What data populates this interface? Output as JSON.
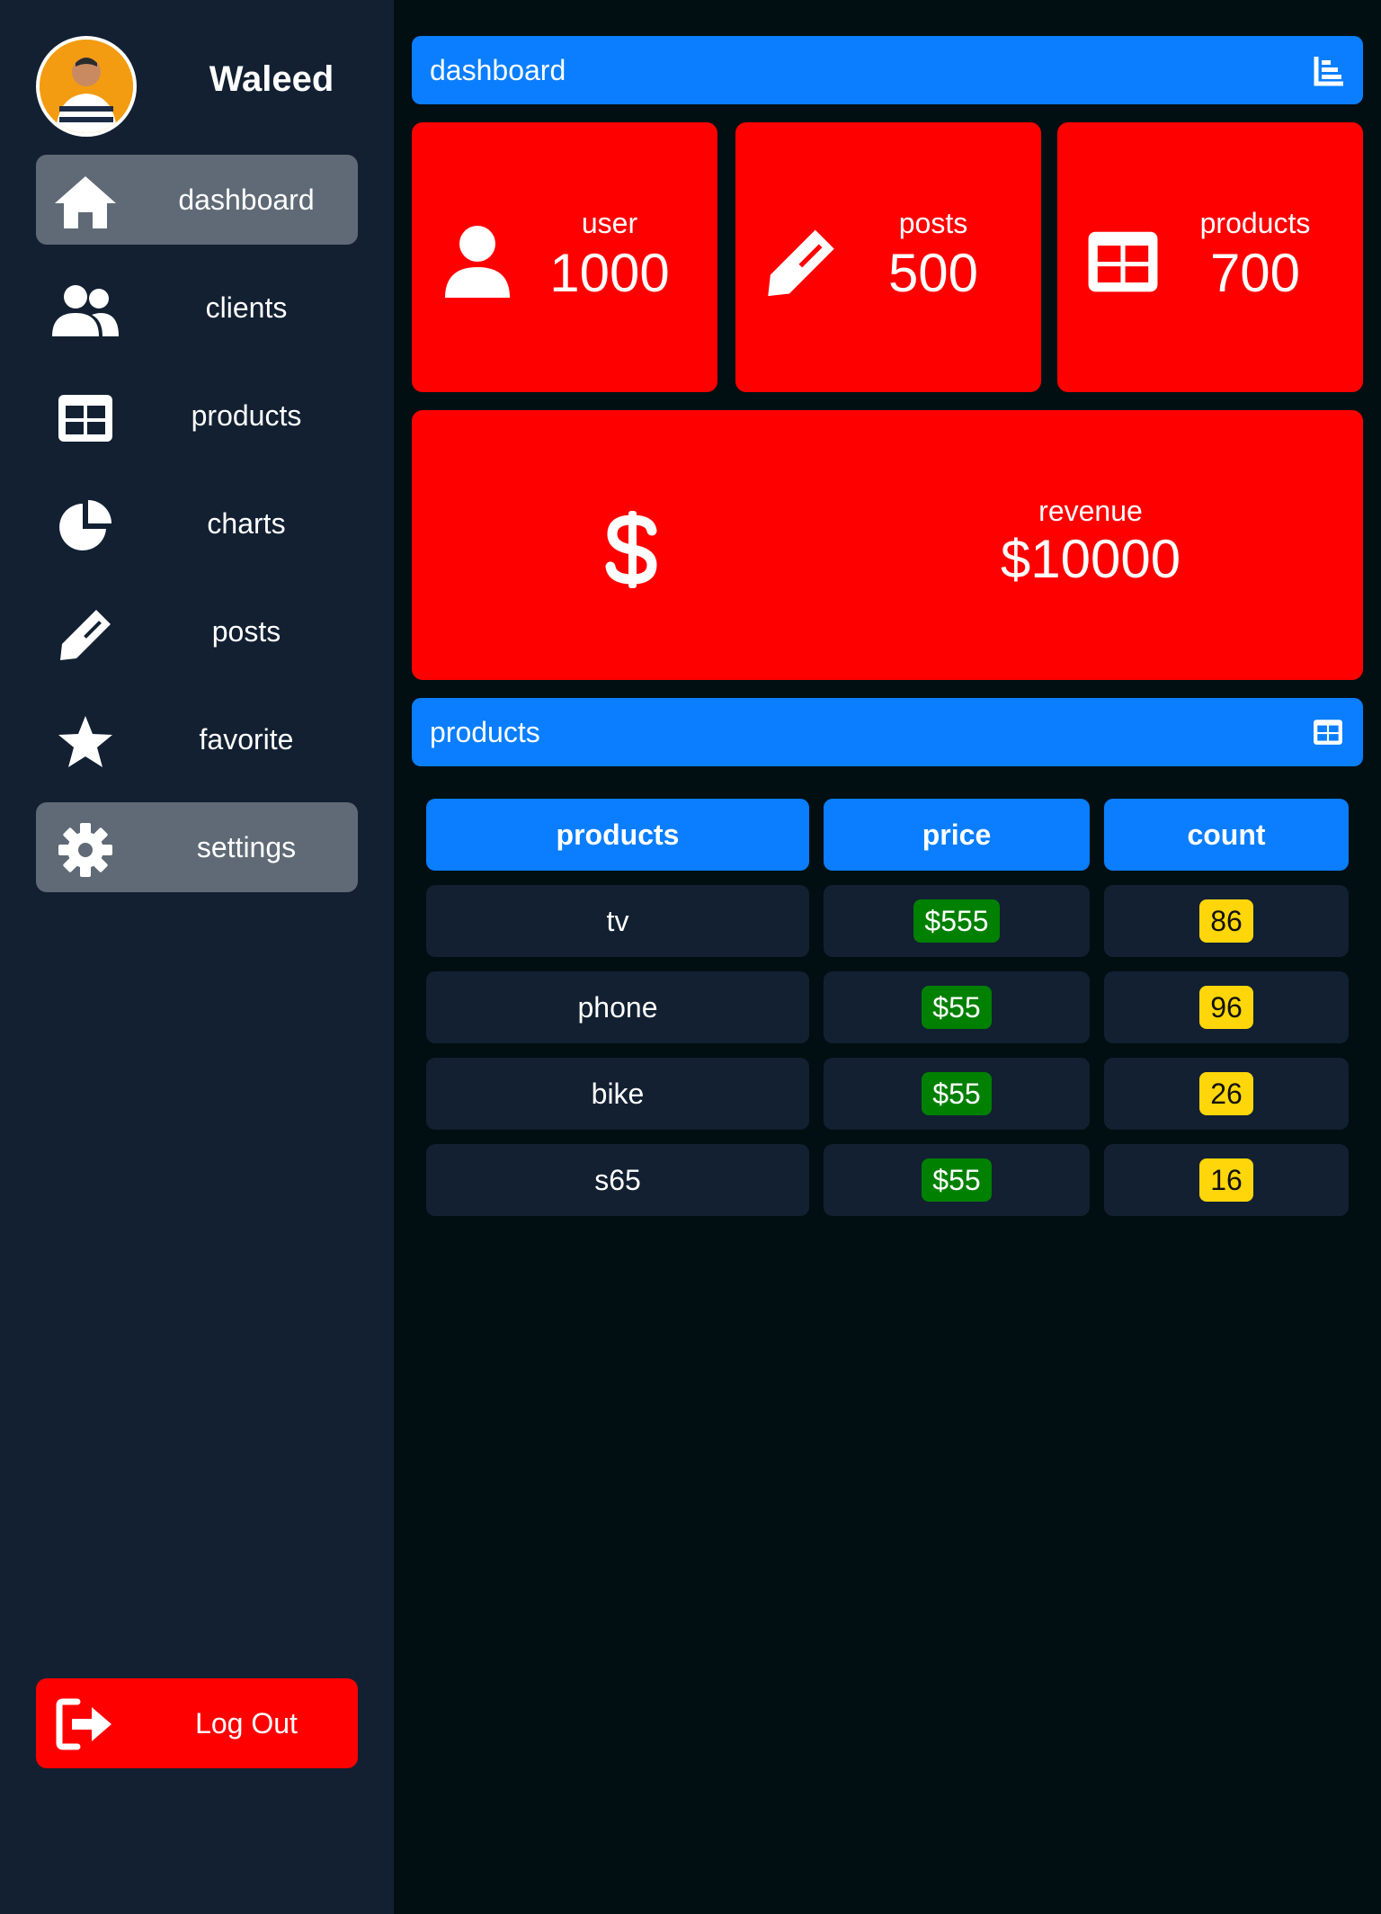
{
  "user": {
    "name": "Waleed"
  },
  "sidebar": {
    "items": [
      {
        "label": "dashboard",
        "icon": "home-icon",
        "active": true
      },
      {
        "label": "clients",
        "icon": "users-icon",
        "active": false
      },
      {
        "label": "products",
        "icon": "table-icon",
        "active": false
      },
      {
        "label": "charts",
        "icon": "pie-chart-icon",
        "active": false
      },
      {
        "label": "posts",
        "icon": "pencil-icon",
        "active": false
      },
      {
        "label": "favorite",
        "icon": "star-icon",
        "active": false
      },
      {
        "label": "settings",
        "icon": "gear-icon",
        "active": true
      }
    ],
    "logout_label": "Log Out"
  },
  "header": {
    "title": "dashboard",
    "icon": "bar-chart-icon"
  },
  "stats": [
    {
      "label": "user",
      "value": "1000",
      "icon": "user-icon"
    },
    {
      "label": "posts",
      "value": "500",
      "icon": "pencil-icon"
    },
    {
      "label": "products",
      "value": "700",
      "icon": "table-icon"
    }
  ],
  "revenue": {
    "label": "revenue",
    "value": "$10000",
    "icon": "dollar-icon"
  },
  "products_section": {
    "title": "products",
    "icon": "table-icon"
  },
  "table": {
    "headers": [
      "products",
      "price",
      "count"
    ],
    "rows": [
      {
        "product": "tv",
        "price": "$555",
        "count": "86"
      },
      {
        "product": "phone",
        "price": "$55",
        "count": "96"
      },
      {
        "product": "bike",
        "price": "$55",
        "count": "26"
      },
      {
        "product": "s65",
        "price": "$55",
        "count": "16"
      }
    ]
  },
  "colors": {
    "sidebar_bg": "#122032",
    "page_bg": "#010f12",
    "accent_blue": "#0a7eff",
    "card_red": "#ff0000",
    "active_item": "#5f6a76",
    "price_badge": "#008000",
    "count_badge": "#ffd60a"
  }
}
